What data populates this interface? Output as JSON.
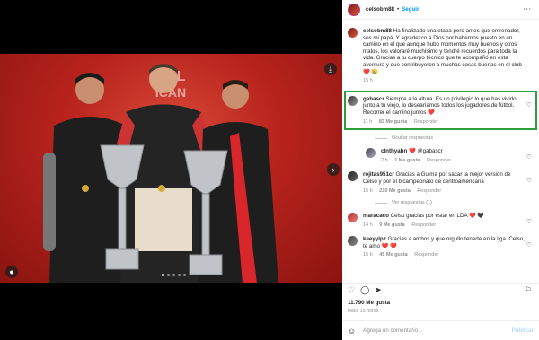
{
  "post": {
    "username": "celsobm88",
    "separator": "•",
    "follow_label": "Seguir",
    "more_label": "···",
    "caption": "Ha finalizado una etapa pero antes que entrenador, sos mi papá. Y agradezco a Dios por habernos puesto en un camino en el que aunque hubo momentos muy buenos y otros malos, los valoraré muchísimo y tendré recuerdos para toda la vida. Gracias a tu cuerpo técnico que te acompañó en esta aventura y que contribuyeron a muchas cosas buenas en el club ❤️ 🥹",
    "caption_time": "15 h"
  },
  "comments": [
    {
      "user": "gabascr",
      "text": "Siempre a la altura. Es un privilegio lo que has vivido junto a tu viejo, lo desearíamos todos los jugadores de fútbol. Recorrer el camino juntos ❤️",
      "time": "11 h",
      "likes": "83 Me gusta",
      "reply": "Responder",
      "highlighted": true,
      "replies_toggle": "Ocultar respuestas",
      "replies": [
        {
          "user": "clnthyabn",
          "text": "❤️ @gabascr",
          "time": "2 h",
          "likes": "1 Me gusta",
          "reply": "Responder"
        }
      ]
    },
    {
      "user": "rojitas951cr",
      "text": "Gracias a Guima por sacar la mejor versión de Celso y por el bicampeonato de centroamericana",
      "time": "15 h",
      "likes": "210 Me gusta",
      "reply": "Responder",
      "replies_toggle": "Ver respuestas (1)"
    },
    {
      "user": "maracaco",
      "text": "Celso gracias por estar en LDA ❤️ 🖤",
      "time": "14 h",
      "likes": "9 Me gusta",
      "reply": "Responder"
    },
    {
      "user": "keeyylpz",
      "text": "Gracias a ambos y que orgullo tenerte en la liga. Celso, te amo ❤️ ❤️",
      "time": "15 h",
      "likes": "45 Me gusta",
      "reply": "Responder"
    }
  ],
  "footer": {
    "likes": "11.790 Me gusta",
    "time": "Hace 15 horas",
    "comment_placeholder": "Agrega un comentario...",
    "post_label": "Publicar"
  },
  "icons": {
    "like": "heart-icon",
    "comment": "comment-icon",
    "share": "share-icon",
    "save": "bookmark-icon"
  }
}
